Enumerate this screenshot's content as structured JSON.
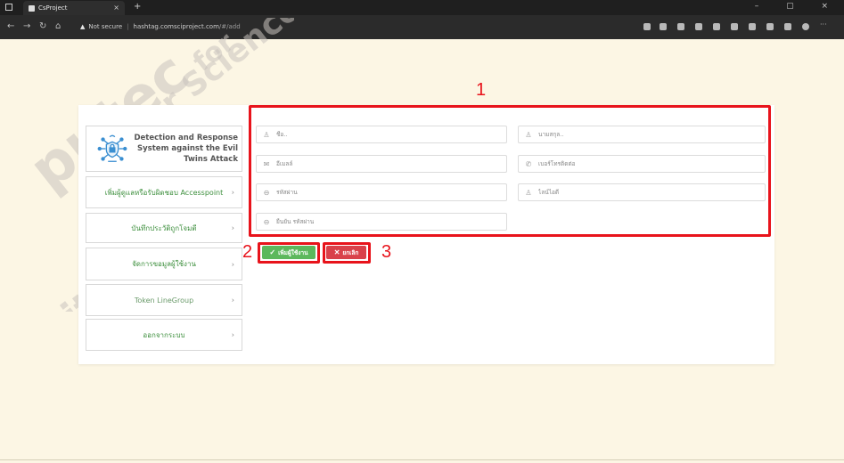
{
  "browser": {
    "tab_title": "CsProject",
    "tab_close": "×",
    "new_tab": "+",
    "security_label": "Not secure",
    "url_host": "hashtag.comsciproject.com",
    "url_path": "/#/add",
    "window_controls": "– ▢ ×"
  },
  "watermark": {
    "lines": [
      "putec",
      "ity of Info",
      "ter Science",
      "for"
    ]
  },
  "sidebar": {
    "logo_title": "Detection and Response System against the Evil Twins Attack",
    "logo_icon": "router-shield-icon",
    "items": [
      {
        "label": "เพิ่มผู้ดูแลหรือรับผิดชอบ Accesspoint"
      },
      {
        "label": "บันทึกประวัติถูกโจมตี"
      },
      {
        "label": "จัดการขอมูลผู้ใช้งาน"
      },
      {
        "label": "Token LineGroup"
      },
      {
        "label": "ออกจากระบบ"
      }
    ],
    "chevron": "›"
  },
  "form": {
    "fields": [
      {
        "placeholder": "ชื่อ..",
        "icon": "user-icon"
      },
      {
        "placeholder": "นามสกุล..",
        "icon": "user-icon"
      },
      {
        "placeholder": "อีเมลล์",
        "icon": "mail-icon"
      },
      {
        "placeholder": "เบอร์โทรติดต่อ",
        "icon": "phone-icon"
      },
      {
        "placeholder": "รหัสผ่าน",
        "icon": "lock-icon"
      },
      {
        "placeholder": "ไลน์ไอดี",
        "icon": "user-icon"
      },
      {
        "placeholder": "ยืนยัน รหัสผ่าน",
        "icon": "lock-icon"
      }
    ],
    "add_button": "เพิ่มผู้ใช้งาน",
    "cancel_button": "ยกเลิก"
  },
  "annotations": {
    "one": "1",
    "two": "2",
    "three": "3",
    "color": "#e8131b"
  },
  "colors": {
    "background": "#fcf6e4",
    "accent_green": "#5cb85c",
    "danger_red": "#d9414a",
    "menu_text_green": "#3d8f3d"
  }
}
